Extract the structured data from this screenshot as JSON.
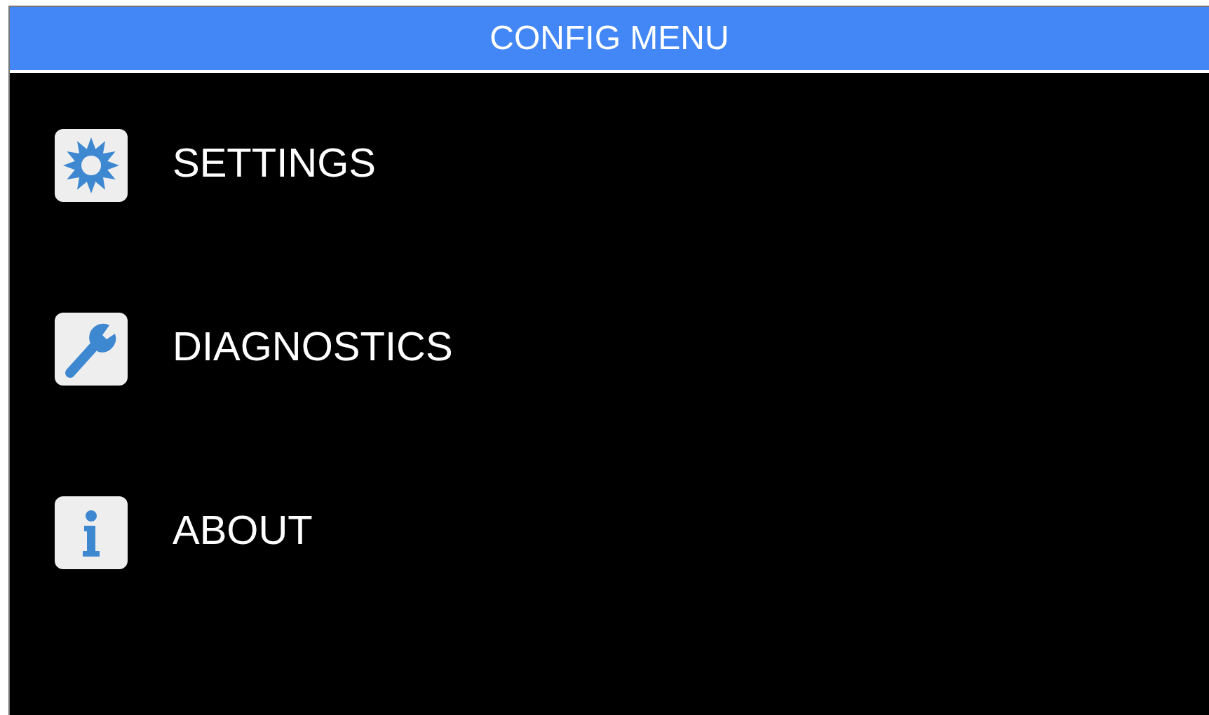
{
  "header": {
    "title": "CONFIG MENU"
  },
  "menu": [
    {
      "label": "SETTINGS",
      "kind": "gear"
    },
    {
      "label": "DIAGNOSTICS",
      "kind": "wrench"
    },
    {
      "label": "ABOUT",
      "kind": "info"
    }
  ]
}
